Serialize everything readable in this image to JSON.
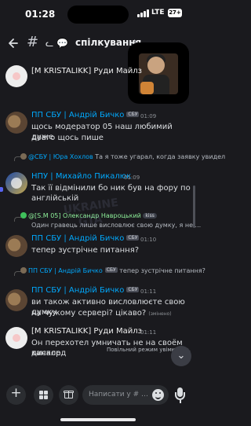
{
  "status_bar": {
    "time": "01:28",
    "network": "LTE",
    "battery_percent": "27+"
  },
  "header": {
    "hash": "#",
    "icons_text": "ᓚ 💬",
    "title": "спілкування",
    "chevron": "›"
  },
  "messages": [
    {
      "author": "[M KRISTALIKK] Руди Майлз",
      "author_color": "#f0f0f0"
    },
    {
      "author": "ПП СБУ | Андрій Бичко",
      "tag": "СБУ",
      "time": "01:09",
      "text_1": "щось модератор 05 наш любимий дуже",
      "text_2": "довго щось пише"
    },
    {
      "reply_author": "@СБУ | Юра Хохлов",
      "reply_text": "Та я тоже угарал, когда заявку увидел",
      "author": "НПУ | Михайло Пикалюк",
      "time": "01:09",
      "text_1": "Так її відмінили бо ник був на фору по",
      "text_2": "англійській"
    },
    {
      "reply_author": "@[S.M 05] Олександр Навроцький",
      "reply_badge": "kiss",
      "reply_text": "Один гравець лише висловлює свою думку, я не ...",
      "author": "ПП СБУ | Андрій Бичко",
      "tag": "СБУ",
      "time": "01:10",
      "text_1": "тепер зустрічне питання?"
    },
    {
      "reply_author": "ПП СБУ | Андрій Бичко",
      "reply_tag": "СБУ",
      "reply_text": "тепер зустрічне питання?",
      "author": "ПП СБУ | Андрій Бичко",
      "tag": "СБУ",
      "time": "01:11",
      "text_1": "ви також активно висловлюєте свою думку",
      "text_2": "на чужому сервері? цікаво?",
      "edited": "(змінено)"
    },
    {
      "author": "[M KRISTALIKK] Руди Майлз",
      "time": "01:11",
      "text_1": "Он перехотел умничать не на своём дискорд",
      "text_2": "канале"
    }
  ],
  "slow_mode_text": "Повільний режим увімкнено.",
  "watermark_text": "UKRAINE GTA",
  "composer": {
    "placeholder": "Написати у # ᓚ 💬 спілкування"
  },
  "colors": {
    "background": "#1a1a1e",
    "author_blue": "#00a8fc",
    "author_green": "#8ef09a",
    "text": "#dbdee1"
  }
}
